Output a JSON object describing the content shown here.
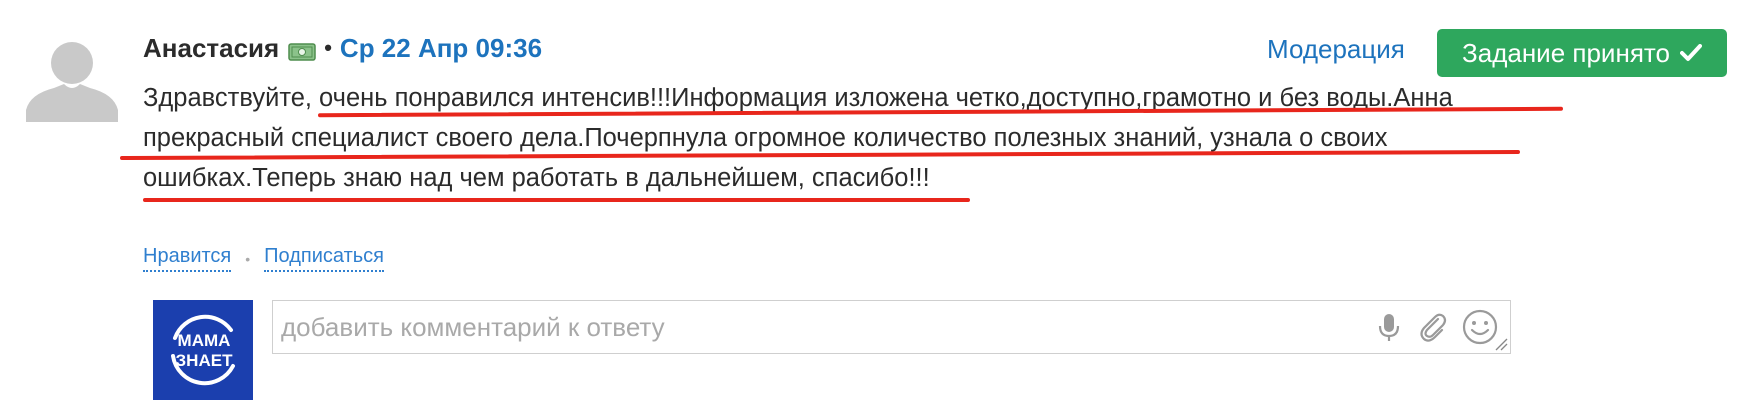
{
  "post": {
    "author": "Анастасия",
    "separator": "•",
    "date": "Ср 22 Апр 09:36",
    "badge_icon": "money-bill-icon",
    "moderation_label": "Модерация",
    "accepted_label": "Задание принято",
    "accepted_icon": "checkmark-icon",
    "accepted_color": "#2ea75d",
    "body_lines": [
      "Здравствуйте, очень понравился интенсив!!!Информация изложена четко,доступно,грамотно и без воды.Анна",
      "прекрасный специалист своего дела.Почерпнула огромное количество полезных знаний, узнала о своих",
      "ошибках.Теперь знаю над чем работать в дальнейшем, спасибо!!!"
    ],
    "underline_color": "#e8261c"
  },
  "actions": {
    "like_label": "Нравится",
    "separator": "•",
    "subscribe_label": "Подписаться"
  },
  "comment": {
    "logo_text_top": "МАМА",
    "logo_text_bottom": "ЗНАЕТ",
    "logo_color": "#1b3fae",
    "placeholder": "добавить комментарий к ответу",
    "icons": [
      "microphone-icon",
      "paperclip-icon",
      "smiley-icon"
    ]
  }
}
